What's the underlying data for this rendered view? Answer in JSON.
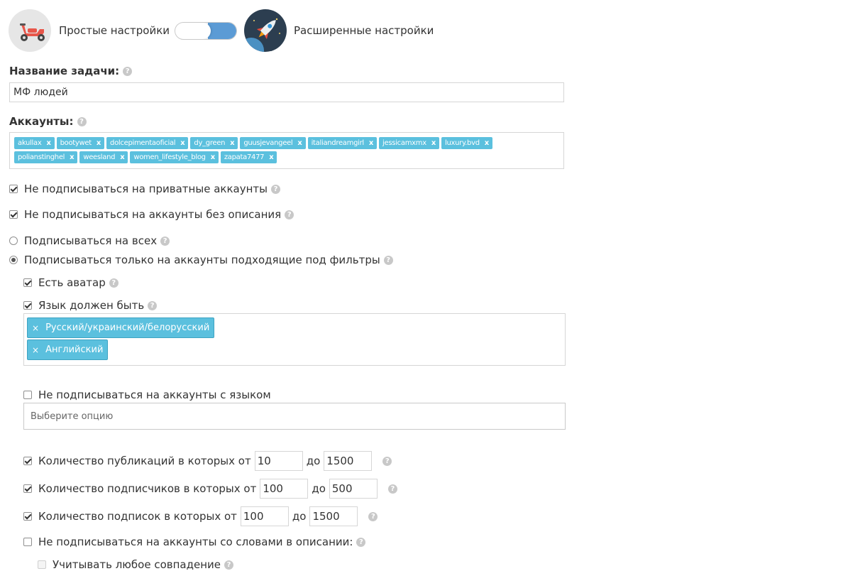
{
  "header": {
    "simple_label": "Простые настройки",
    "advanced_label": "Расширенные настройки",
    "toggle_state": "advanced"
  },
  "task": {
    "label": "Название задачи:",
    "value": "МФ людей"
  },
  "accounts": {
    "label": "Аккаунты:",
    "tags": [
      "akullax",
      "bootywet",
      "dolcepimentaoficial",
      "dy_green",
      "guusjevangeel",
      "italiandreamgirl",
      "jessicamxmx",
      "luxury.bvd",
      "polianstinghel",
      "weesland",
      "women_lifestyle_blog",
      "zapata7477"
    ],
    "remove_symbol": "x"
  },
  "options": {
    "no_private": "Не подписываться на приватные аккаунты",
    "no_empty_bio": "Не подписываться на аккаунты без описания",
    "follow_all": "Подписываться на всех",
    "follow_filtered": "Подписываться только на аккаунты подходящие под фильтры"
  },
  "filters": {
    "has_avatar": "Есть аватар",
    "language_must_be": "Язык должен быть",
    "languages": [
      "Русский/украинский/белорусский",
      "Английский"
    ],
    "remove_symbol": "×",
    "exclude_language": "Не подписываться на аккаунты с языком",
    "exclude_language_placeholder": "Выберите опцию",
    "posts_label": "Количество публикаций в которых от",
    "posts_from": "10",
    "posts_to": "1500",
    "followers_label": "Количество подписчиков в которых от",
    "followers_from": "100",
    "followers_to": "500",
    "following_label": "Количество подписок в которых от",
    "following_from": "100",
    "following_to": "1500",
    "to_word": "до",
    "bio_words": "Не подписываться на аккаунты со словами в описании:",
    "any_match": "Учитывать любое совпадение"
  },
  "help_symbol": "?",
  "colors": {
    "tag_bg": "#5bc0de",
    "toggle_on": "#5b9bd5",
    "help_icon": "#c8c8c8"
  }
}
